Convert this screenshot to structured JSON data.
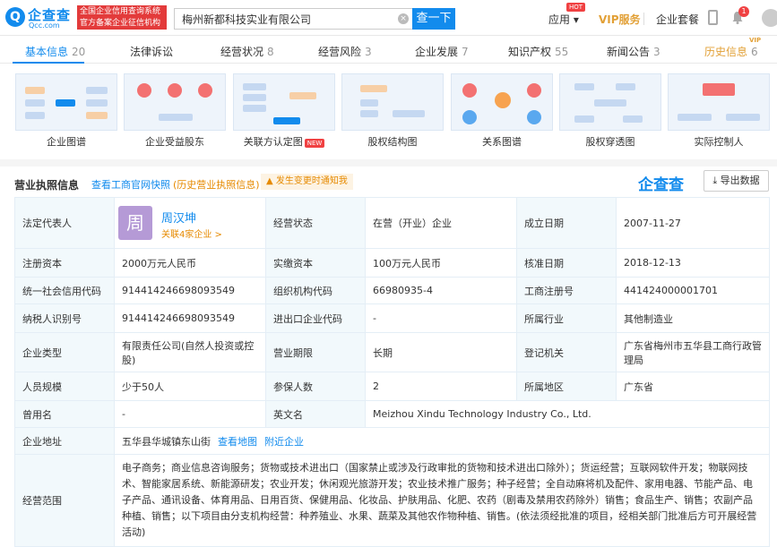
{
  "header": {
    "logo_cn": "企查查",
    "logo_en": "Qcc.com",
    "slogan_line1": "全国企业信用查询系统",
    "slogan_line2": "官方备案企业征信机构",
    "search_value": "梅州新都科技实业有限公司",
    "search_button": "查一下",
    "nav_app": "应用",
    "hot_badge": "HOT",
    "nav_vip": "VIP服务",
    "nav_package": "企业套餐",
    "notification_count": "1"
  },
  "tabs": [
    {
      "label": "基本信息",
      "count": "20"
    },
    {
      "label": "法律诉讼",
      "count": ""
    },
    {
      "label": "经营状况",
      "count": "8"
    },
    {
      "label": "经营风险",
      "count": "3"
    },
    {
      "label": "企业发展",
      "count": "7"
    },
    {
      "label": "知识产权",
      "count": "55"
    },
    {
      "label": "新闻公告",
      "count": "3"
    },
    {
      "label": "历史信息",
      "count": "6"
    }
  ],
  "vip_tag": "VIP",
  "thumbnails": [
    {
      "label": "企业图谱"
    },
    {
      "label": "企业受益股东"
    },
    {
      "label": "关联方认定图",
      "tag": "NEW"
    },
    {
      "label": "股权结构图"
    },
    {
      "label": "关系图谱"
    },
    {
      "label": "股权穿透图"
    },
    {
      "label": "实际控制人"
    }
  ],
  "section": {
    "title": "营业执照信息",
    "link_gsj": "查看工商官网快照",
    "link_history": "(历史营业执照信息)",
    "notice": "发生变更时通知我",
    "watermark": "企查查",
    "export": "导出数据"
  },
  "info": {
    "legal_rep_key": "法定代表人",
    "legal_rep_avatar": "周",
    "legal_rep_name": "周汉坤",
    "legal_rep_link": "关联4家企业 >",
    "status_key": "经营状态",
    "status_val": "在营（开业）企业",
    "founded_key": "成立日期",
    "founded_val": "2007-11-27",
    "reg_cap_key": "注册资本",
    "reg_cap_val": "2000万元人民币",
    "paid_cap_key": "实缴资本",
    "paid_cap_val": "100万元人民币",
    "approve_key": "核准日期",
    "approve_val": "2018-12-13",
    "credit_key": "统一社会信用代码",
    "credit_val": "914414246698093549",
    "org_key": "组织机构代码",
    "org_val": "66980935-4",
    "reg_no_key": "工商注册号",
    "reg_no_val": "441424000001701",
    "tax_key": "纳税人识别号",
    "tax_val": "914414246698093549",
    "imp_key": "进出口企业代码",
    "imp_val": "-",
    "industry_key": "所属行业",
    "industry_val": "其他制造业",
    "type_key": "企业类型",
    "type_val": "有限责任公司(自然人投资或控股)",
    "term_key": "营业期限",
    "term_val": "长期",
    "authority_key": "登记机关",
    "authority_val": "广东省梅州市五华县工商行政管理局",
    "staff_key": "人员规模",
    "staff_val": "少于50人",
    "insured_key": "参保人数",
    "insured_val": "2",
    "region_key": "所属地区",
    "region_val": "广东省",
    "former_key": "曾用名",
    "former_val": "-",
    "en_key": "英文名",
    "en_val": "Meizhou Xindu Technology Industry Co., Ltd.",
    "addr_key": "企业地址",
    "addr_val": "五华县华城镇东山街",
    "addr_map": "查看地图",
    "addr_nearby": "附近企业",
    "scope_key": "经营范围",
    "scope_val": "电子商务；商业信息咨询服务；货物或技术进出口（国家禁止或涉及行政审批的货物和技术进出口除外）；货运经营；互联网软件开发；物联网技术、智能家居系统、新能源研发；农业开发；休闲观光旅游开发；农业技术推广服务；种子经营；全自动麻将机及配件、家用电器、节能产品、电子产品、通讯设备、体育用品、日用百货、保健用品、化妆品、护肤用品、化肥、农药（剧毒及禁用农药除外）销售；食品生产、销售；农副产品种植、销售；以下项目由分支机构经营：种养殖业、水果、蔬菜及其他农作物种植、销售。(依法须经批准的项目，经相关部门批准后方可开展经营活动)"
  }
}
